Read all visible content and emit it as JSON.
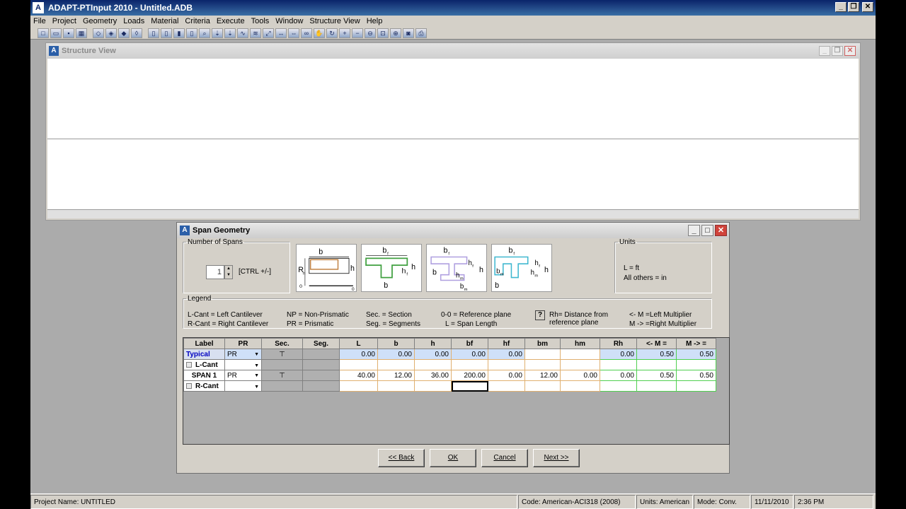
{
  "window": {
    "title": "ADAPT-PTInput 2010 - Untitled.ADB",
    "app_icon": "A"
  },
  "menu": [
    "File",
    "Project",
    "Geometry",
    "Loads",
    "Material",
    "Criteria",
    "Execute",
    "Tools",
    "Window",
    "Structure View",
    "Help"
  ],
  "structure_view": {
    "title": "Structure View"
  },
  "span_geometry": {
    "title": "Span Geometry",
    "number_of_spans": {
      "legend": "Number of Spans",
      "value": "1",
      "hint": "[CTRL +/-]"
    },
    "section_labels": {
      "s1": {
        "b_top": "b",
        "rh": "R",
        "rh_sub": "h",
        "h": "h",
        "o1": "0",
        "o2": "0"
      },
      "s2": {
        "bf": "b",
        "bf_sub": "f",
        "hf": "h",
        "hf_sub": "f",
        "h": "h",
        "b": "b"
      },
      "s3": {
        "bf": "b",
        "bf_sub": "f",
        "hf": "h",
        "hf_sub": "f",
        "h": "h",
        "hm": "h",
        "hm_sub": "m",
        "b": "b",
        "bm": "b",
        "bm_sub": "m"
      },
      "s4": {
        "bf": "b",
        "bf_sub": "f",
        "hf": "h",
        "hf_sub": "f",
        "h": "h",
        "hm": "h",
        "hm_sub": "m",
        "b": "b",
        "bm": "b",
        "bm_sub": "m"
      }
    },
    "units": {
      "legend": "Units",
      "line1": "L =   ft",
      "line2": "All others = in"
    },
    "legend": {
      "title": "Legend",
      "lcant": "L-Cant = Left Cantilever",
      "rcant": "R-Cant = Right Cantilever",
      "np": "NP = Non-Prismatic",
      "pr": "PR = Prismatic",
      "sec": "Sec. = Section",
      "seg": "Seg. = Segments",
      "oo": "0-0 = Reference plane",
      "l": "L  =  Span Length",
      "help": "?",
      "rh1": "Rh= Distance from",
      "rh2": "reference plane",
      "lm": "<- M =Left Multiplier",
      "rm": "M -> =Right Multiplier"
    },
    "columns": [
      "Label",
      "PR",
      "Sec.",
      "Seg.",
      "L",
      "b",
      "h",
      "bf",
      "hf",
      "bm",
      "hm",
      "Rh",
      "<- M =",
      "M -> ="
    ],
    "rows": [
      {
        "label": "Typical",
        "pr": "PR",
        "L": "0.00",
        "b": "0.00",
        "h": "0.00",
        "bf": "0.00",
        "hf": "0.00",
        "bm": "",
        "hm": "",
        "Rh": "0.00",
        "lm": "0.50",
        "rm": "0.50"
      },
      {
        "label": "L-Cant",
        "pr": "",
        "L": "",
        "b": "",
        "h": "",
        "bf": "",
        "hf": "",
        "bm": "",
        "hm": "",
        "Rh": "",
        "lm": "",
        "rm": ""
      },
      {
        "label": "SPAN 1",
        "pr": "PR",
        "L": "40.00",
        "b": "12.00",
        "h": "36.00",
        "bf": "200.00",
        "hf": "0.00",
        "bm": "12.00",
        "hm": "0.00",
        "Rh": "0.00",
        "lm": "0.50",
        "rm": "0.50"
      },
      {
        "label": "R-Cant",
        "pr": "",
        "L": "",
        "b": "",
        "h": "",
        "bf": "",
        "hf": "",
        "bm": "",
        "hm": "",
        "Rh": "",
        "lm": "",
        "rm": ""
      }
    ],
    "buttons": {
      "back": "<< Back",
      "ok": "OK",
      "cancel": "Cancel",
      "next": "Next >>"
    }
  },
  "status": {
    "project": "Project Name: UNTITLED",
    "code": "Code: American-ACI318 (2008)",
    "units": "Units: American",
    "mode": "Mode: Conv.",
    "date": "11/11/2010",
    "time": "2:36 PM"
  }
}
